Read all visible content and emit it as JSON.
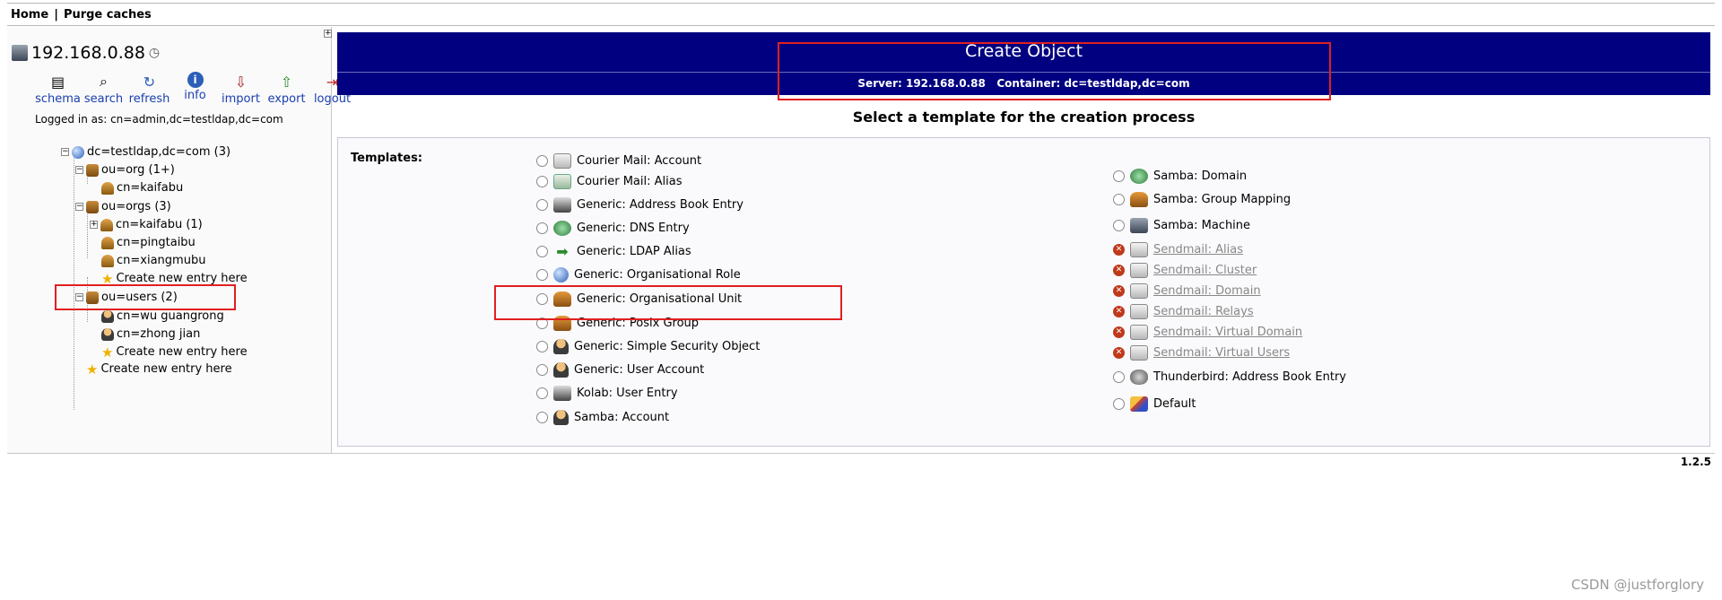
{
  "breadcrumb": {
    "home": "Home",
    "separator": "|",
    "purge": "Purge caches"
  },
  "tree_panel": {
    "expand_glyph": "+",
    "server": "192.168.0.88",
    "toolbar": [
      {
        "key": "schema",
        "label": "schema",
        "icon": "schema-icon"
      },
      {
        "key": "search",
        "label": "search",
        "icon": "search-icon"
      },
      {
        "key": "refresh",
        "label": "refresh",
        "icon": "refresh-icon"
      },
      {
        "key": "info",
        "label": "info",
        "icon": "info-icon"
      },
      {
        "key": "import",
        "label": "import",
        "icon": "import-icon"
      },
      {
        "key": "export",
        "label": "export",
        "icon": "export-icon"
      },
      {
        "key": "logout",
        "label": "logout",
        "icon": "logout-icon"
      }
    ],
    "logged_in": "Logged in as: cn=admin,dc=testldap,dc=com",
    "nodes": {
      "root": "dc=testldap,dc=com (3)",
      "ou_org": "ou=org (1+)",
      "cn_kaifabu_1": "cn=kaifabu",
      "ou_orgs": "ou=orgs (3)",
      "cn_kaifabu_2": "cn=kaifabu (1)",
      "cn_pingtaibu": "cn=pingtaibu",
      "cn_xiangmubu": "cn=xiangmubu",
      "create_orgs": "Create new entry here",
      "ou_users": "ou=users (2)",
      "cn_wu": "cn=wu guangrong",
      "cn_zhong": "cn=zhong jian",
      "create_users": "Create new entry here",
      "create_root": "Create new entry here"
    }
  },
  "main": {
    "title": "Create Object",
    "server_label": "Server:",
    "server_value": "192.168.0.88",
    "container_label": "Container:",
    "container_value": "dc=testldap,dc=com",
    "subtitle": "Select a template for the creation process",
    "templates_label": "Templates:",
    "left_templates": [
      {
        "label": "Courier Mail: Account",
        "icon": "mail-account-icon"
      },
      {
        "label": "Courier Mail: Alias",
        "icon": "mail-alias-icon"
      },
      {
        "label": "Generic: Address Book Entry",
        "icon": "address-book-icon"
      },
      {
        "label": "Generic: DNS Entry",
        "icon": "dns-icon"
      },
      {
        "label": "Generic: LDAP Alias",
        "icon": "arrow-right-icon"
      },
      {
        "label": "Generic: Organisational Role",
        "icon": "globe-icon"
      },
      {
        "label": "Generic: Organisational Unit",
        "icon": "org-unit-icon"
      },
      {
        "label": "Generic: Posix Group",
        "icon": "group-icon"
      },
      {
        "label": "Generic: Simple Security Object",
        "icon": "user-icon"
      },
      {
        "label": "Generic: User Account",
        "icon": "user-icon"
      },
      {
        "label": "Kolab: User Entry",
        "icon": "address-book-icon"
      },
      {
        "label": "Samba: Account",
        "icon": "user-icon"
      }
    ],
    "right_templates": [
      {
        "label": "Samba: Domain",
        "icon": "dns-icon",
        "disabled": false
      },
      {
        "label": "Samba: Group Mapping",
        "icon": "group-icon",
        "disabled": false
      },
      {
        "label": "Samba: Machine",
        "icon": "monitor-icon",
        "disabled": false
      },
      {
        "label": "Sendmail: Alias",
        "icon": "mail-icon",
        "disabled": true
      },
      {
        "label": "Sendmail: Cluster",
        "icon": "mail-icon",
        "disabled": true
      },
      {
        "label": "Sendmail: Domain",
        "icon": "mail-icon",
        "disabled": true
      },
      {
        "label": "Sendmail: Relays",
        "icon": "mail-icon",
        "disabled": true
      },
      {
        "label": "Sendmail: Virtual Domain",
        "icon": "mail-icon",
        "disabled": true
      },
      {
        "label": "Sendmail: Virtual Users",
        "icon": "mail-icon",
        "disabled": true
      },
      {
        "label": "Thunderbird: Address Book Entry",
        "icon": "thunderbird-icon",
        "disabled": false
      },
      {
        "label": "Default",
        "icon": "default-template-icon",
        "disabled": false
      }
    ]
  },
  "version": "1.2.5",
  "watermark": "CSDN @justforglory",
  "colors": {
    "header_bg": "#000080",
    "annotation": "#e02020",
    "link": "#1a3fb0",
    "disabled_x": "#c0391b"
  }
}
